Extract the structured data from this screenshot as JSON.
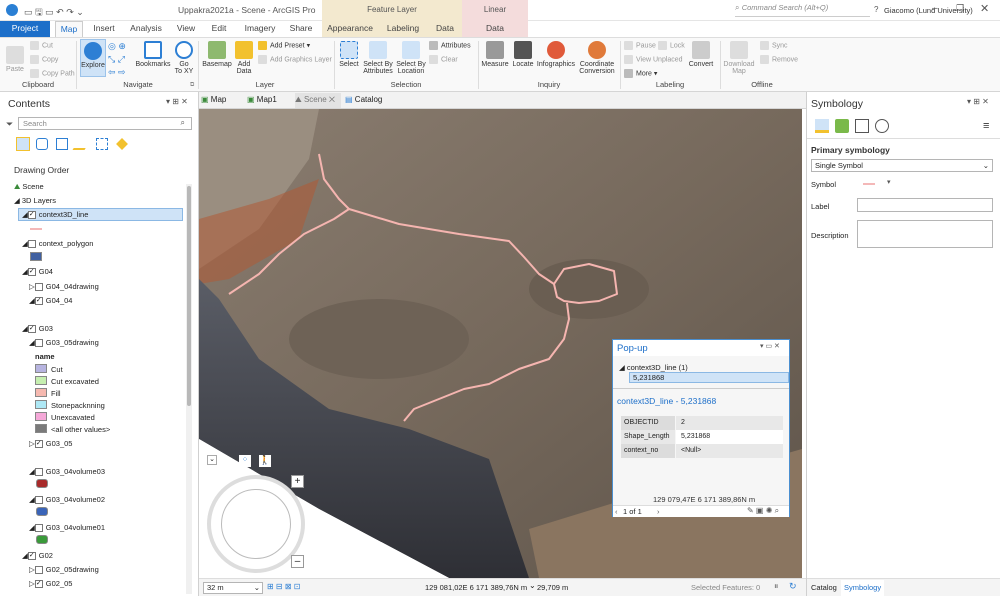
{
  "window": {
    "title": "Uppakra2021a - Scene - ArcGIS Pro",
    "search_placeholder": "Command Search (Alt+Q)",
    "user": "Giacomo (Lund University)",
    "help": "?"
  },
  "context_tabs": {
    "feature_layer": "Feature Layer",
    "linear_referencing": "Linear Referencing"
  },
  "tabs": [
    "Project",
    "Map",
    "Insert",
    "Analysis",
    "View",
    "Edit",
    "Imagery",
    "Share",
    "Appearance",
    "Labeling",
    "Data",
    "Data"
  ],
  "ribbon": {
    "clipboard": {
      "paste": "Paste",
      "cut": "Cut",
      "copy": "Copy",
      "copy_path": "Copy Path",
      "group": "Clipboard"
    },
    "navigate": {
      "explore": "Explore",
      "bookmarks": "Bookmarks",
      "go_to_xy_1": "Go",
      "go_to_xy_2": "To XY",
      "group": "Navigate"
    },
    "layer": {
      "basemap": "Basemap",
      "add_data": "Add",
      "add_data_2": "Data",
      "add_preset": "Add Preset",
      "add_graphics": "Add Graphics Layer",
      "group": "Layer"
    },
    "selection": {
      "select": "Select",
      "select_attr_1": "Select By",
      "select_attr_2": "Attributes",
      "select_loc_1": "Select By",
      "select_loc_2": "Location",
      "attributes": "Attributes",
      "clear": "Clear",
      "group": "Selection"
    },
    "inquiry": {
      "measure": "Measure",
      "locate": "Locate",
      "infographics": "Infographics",
      "coord_1": "Coordinate",
      "coord_2": "Conversion",
      "group": "Inquiry"
    },
    "labeling": {
      "pause": "Pause",
      "lock": "Lock",
      "view_unplaced": "View Unplaced",
      "more": "More",
      "convert": "Convert",
      "group": "Labeling"
    },
    "offline": {
      "download_1": "Download",
      "download_2": "Map",
      "sync": "Sync",
      "remove": "Remove",
      "group": "Offline"
    }
  },
  "contents": {
    "title": "Contents",
    "search_placeholder": "Search",
    "drawing_order": "Drawing Order",
    "items": [
      {
        "label": "Scene"
      },
      {
        "label": "3D Layers"
      },
      {
        "label": "context3D_line"
      },
      {
        "label": "context_polygon"
      },
      {
        "label": "G04"
      },
      {
        "label": "G04_04drawing"
      },
      {
        "label": "G04_04"
      },
      {
        "label": "G03"
      },
      {
        "label": "G03_05drawing"
      },
      {
        "label": "name"
      },
      {
        "label": "Cut"
      },
      {
        "label": "Cut excavated"
      },
      {
        "label": "Fill"
      },
      {
        "label": "Stonepacknning"
      },
      {
        "label": "Unexcavated"
      },
      {
        "label": "<all other values>"
      },
      {
        "label": "G03_05"
      },
      {
        "label": "G03_04volume03"
      },
      {
        "label": "G03_04volume02"
      },
      {
        "label": "G03_04volume01"
      },
      {
        "label": "G02"
      },
      {
        "label": "G02_05drawing"
      },
      {
        "label": "G02_05"
      }
    ],
    "colors": {
      "cut": "#b7b4e0",
      "cut_excavated": "#c6efb0",
      "fill": "#f6b9b0",
      "stonepacking": "#aee8f5",
      "unexcavated": "#f5a8d8",
      "other": "#7a7a7a",
      "polygon": "#4060a0",
      "vol03": "#a82a2a",
      "vol02": "#3a64b8",
      "vol01": "#3a9a3a",
      "line": "#f4b8b8"
    }
  },
  "view_tabs": [
    "Map",
    "Map1",
    "Scene",
    "Catalog"
  ],
  "status": {
    "scale": "32 m",
    "coords": "129 081,02E 6 171 389,76N m",
    "elevation": "29,709 m",
    "selected": "Selected Features: 0"
  },
  "popup": {
    "title": "Pop-up",
    "layer": "context3D_line  (1)",
    "value": "5,231868",
    "heading": "context3D_line - 5,231868",
    "fields": [
      {
        "name": "OBJECTID",
        "value": "2"
      },
      {
        "name": "Shape_Length",
        "value": "5,231868"
      },
      {
        "name": "context_no",
        "value": "<Null>"
      }
    ],
    "coords": "129 079,47E 6 171 389,86N m",
    "pager": "1 of 1"
  },
  "symbology": {
    "title": "Symbology",
    "primary": "Primary symbology",
    "method": "Single Symbol",
    "symbol_label": "Symbol",
    "label_label": "Label",
    "description_label": "Description",
    "bottom_tabs": [
      "Catalog",
      "Symbology"
    ]
  }
}
